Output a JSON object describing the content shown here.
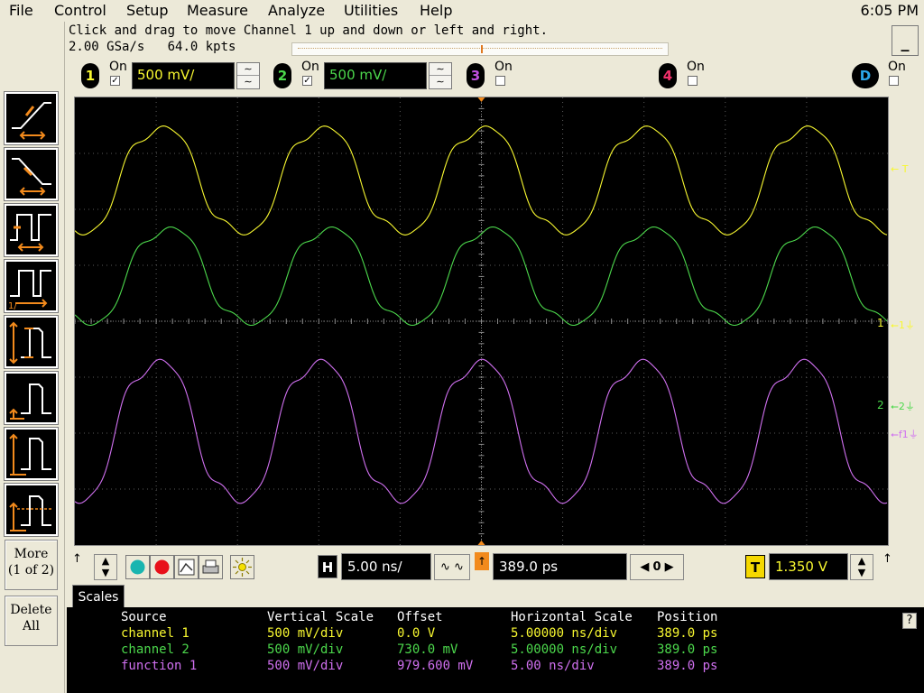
{
  "menu": {
    "file": "File",
    "control": "Control",
    "setup": "Setup",
    "measure": "Measure",
    "analyze": "Analyze",
    "utilities": "Utilities",
    "help": "Help"
  },
  "clock": "6:05 PM",
  "status": {
    "message": "Click and drag to move Channel 1 up and down or left and right.",
    "sample_rate": "2.00 GSa/s",
    "memory": "64.0 kpts",
    "minimize": "_"
  },
  "channels": [
    {
      "num": "1",
      "on_label": "On",
      "checked": true,
      "scale": "500 mV/",
      "color": "#f8f830"
    },
    {
      "num": "2",
      "on_label": "On",
      "checked": true,
      "scale": "500 mV/",
      "color": "#4cd84c"
    },
    {
      "num": "3",
      "on_label": "On",
      "checked": false,
      "color": "#c050e0"
    },
    {
      "num": "4",
      "on_label": "On",
      "checked": false,
      "color": "#f0306a"
    },
    {
      "num": "D",
      "on_label": "On",
      "checked": false,
      "color": "#2ba6e8"
    }
  ],
  "side": {
    "more_line1": "More",
    "more_line2": "(1 of 2)",
    "delete_line1": "Delete",
    "delete_line2": "All"
  },
  "markers": {
    "trigger": "T",
    "ch1": "1",
    "ch2": "2",
    "ch1_ref": "1",
    "ch2_ref": "2",
    "f1_ref": "f1"
  },
  "horizontal": {
    "h_label": "H",
    "scale": "5.00 ns/",
    "position": "389.0 ps",
    "delay_step": "0",
    "t_label": "T",
    "trigger_level": "1.350 V"
  },
  "measurements": {
    "tab": "Scales",
    "headers": [
      "Source",
      "Vertical Scale",
      "Offset",
      "Horizontal Scale",
      "Position"
    ],
    "rows": [
      {
        "source": "channel 1",
        "vscale": "500 mV/div",
        "offset": "0.0 V",
        "hscale": "5.00000 ns/div",
        "position": "389.0 ps",
        "color": "#f8f830"
      },
      {
        "source": "channel 2",
        "vscale": "500 mV/div",
        "offset": "730.0 mV",
        "hscale": "5.00000 ns/div",
        "position": "389.0 ps",
        "color": "#4cd84c"
      },
      {
        "source": "function 1",
        "vscale": "500 mV/div",
        "offset": "979.600 mV",
        "hscale": "5.00 ns/div",
        "position": "389.0 ps",
        "color": "#d070f0"
      }
    ],
    "help": "?"
  }
}
